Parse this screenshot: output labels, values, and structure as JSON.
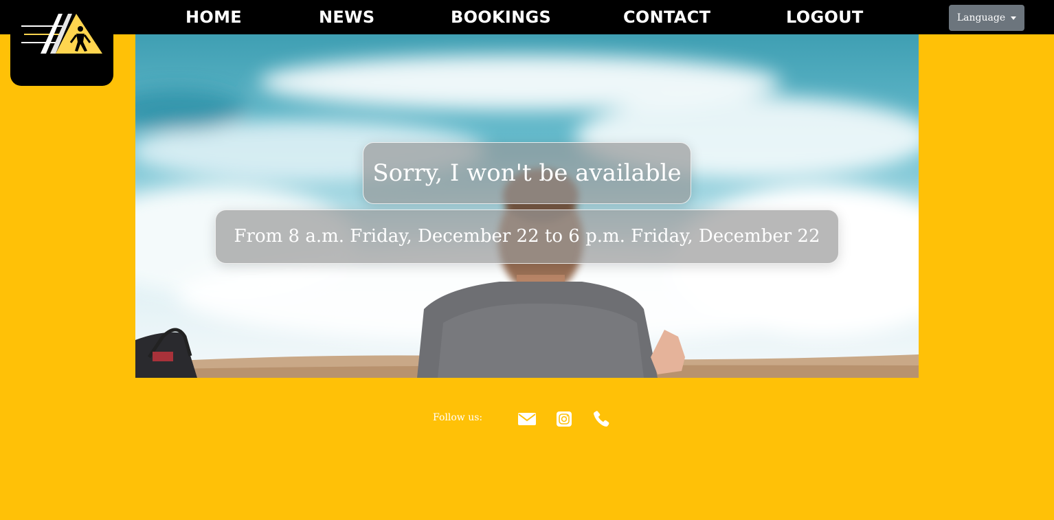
{
  "nav": {
    "items": [
      {
        "label": "HOME"
      },
      {
        "label": "NEWS"
      },
      {
        "label": "BOOKINGS"
      },
      {
        "label": "CONTACT"
      },
      {
        "label": "LOGOUT"
      }
    ],
    "language_label": "Language"
  },
  "logo": {
    "icon": "triangle-athlete-logo"
  },
  "hero": {
    "title": "Sorry, I won't be available",
    "subtitle": "From 8 a.m. Friday, December 22 to 6 p.m. Friday, December 22"
  },
  "footer": {
    "follow_label": "Follow us:",
    "icons": [
      "envelope-icon",
      "instagram-icon",
      "phone-icon"
    ]
  },
  "colors": {
    "background": "#ffc107",
    "navbar": "#000000",
    "language_button": "#6c757d"
  }
}
